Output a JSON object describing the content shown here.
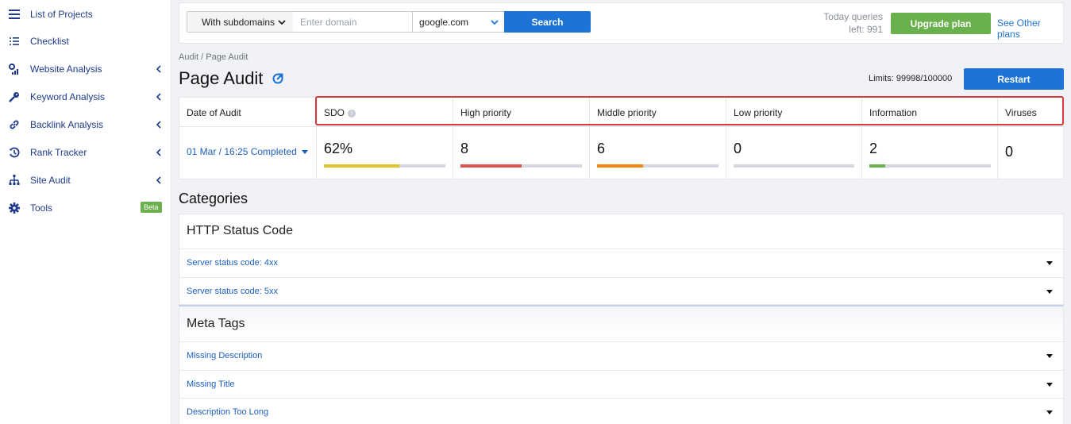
{
  "sidebar": {
    "items": [
      {
        "label": "List of Projects",
        "icon": "list-icon",
        "has_chevron": false
      },
      {
        "label": "Checklist",
        "icon": "checklist-icon",
        "has_chevron": false
      },
      {
        "label": "Website Analysis",
        "icon": "analytics-icon",
        "has_chevron": true
      },
      {
        "label": "Keyword Analysis",
        "icon": "key-icon",
        "has_chevron": true
      },
      {
        "label": "Backlink Analysis",
        "icon": "link-icon",
        "has_chevron": true
      },
      {
        "label": "Rank Tracker",
        "icon": "history-icon",
        "has_chevron": true
      },
      {
        "label": "Site Audit",
        "icon": "sitemap-icon",
        "has_chevron": true
      },
      {
        "label": "Tools",
        "icon": "gear-icon",
        "has_chevron": false,
        "badge": "Beta"
      }
    ]
  },
  "search": {
    "subdomains_value": "With subdomains",
    "domain_placeholder": "Enter domain",
    "domain_value": "",
    "engine_value": "google.com",
    "search_label": "Search"
  },
  "account": {
    "queries_line1": "Today queries",
    "queries_line2": "left: 991",
    "upgrade_label": "Upgrade plan",
    "other_plans_label": "See Other plans"
  },
  "header": {
    "breadcrumb": "Audit / Page Audit",
    "title": "Page Audit",
    "limits": "Limits: 99998/100000",
    "restart_label": "Restart"
  },
  "audit": {
    "date_header": "Date of Audit",
    "date_value": "01 Mar / 16:25 Completed",
    "columns": [
      {
        "header": "SDO",
        "value": "62%",
        "fill": 0.62,
        "color": "#e0c22a",
        "info": true
      },
      {
        "header": "High priority",
        "value": "8",
        "fill": 0.5,
        "color": "#d9534f"
      },
      {
        "header": "Middle priority",
        "value": "6",
        "fill": 0.38,
        "color": "#f0890a"
      },
      {
        "header": "Low priority",
        "value": "0",
        "fill": 0.0,
        "color": "#9aa0a8"
      },
      {
        "header": "Information",
        "value": "2",
        "fill": 0.13,
        "color": "#6ab04c"
      },
      {
        "header": "Viruses",
        "value": "0"
      }
    ]
  },
  "categories": {
    "title": "Categories",
    "groups": [
      {
        "title": "HTTP Status Code",
        "rows": [
          "Server status code: 4xx",
          "Server status code: 5xx"
        ]
      },
      {
        "title": "Meta Tags",
        "rows": [
          "Missing Description",
          "Missing Title",
          "Description Too Long"
        ]
      }
    ]
  },
  "colors": {
    "accent_blue": "#1d74d6",
    "upgrade_green": "#6ab04c",
    "highlight_red": "#d9393e"
  }
}
